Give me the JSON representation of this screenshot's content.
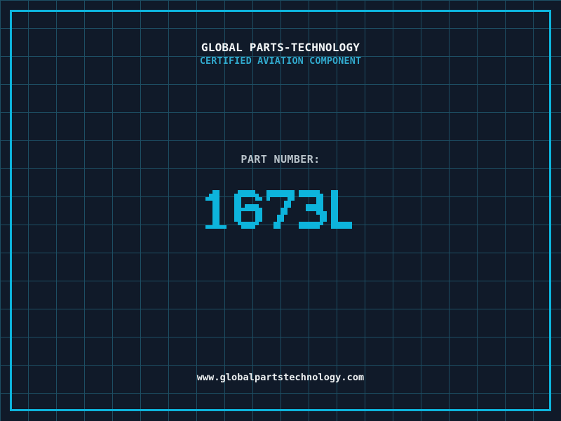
{
  "theme": {
    "bg": "#101a29",
    "grid": "#1d4e63",
    "accent": "#0db4dc",
    "title_color": "#f2f5f6",
    "tagline_color": "#31a9cd",
    "label_color": "#b9c3ca",
    "url_color": "#edf0f1"
  },
  "header": {
    "company_name": "GLOBAL PARTS-TECHNOLOGY",
    "tagline": "CERTIFIED AVIATION COMPONENT"
  },
  "part": {
    "label": "PART NUMBER:",
    "value": "1673L"
  },
  "footer": {
    "website": "www.globalpartstechnology.com"
  }
}
